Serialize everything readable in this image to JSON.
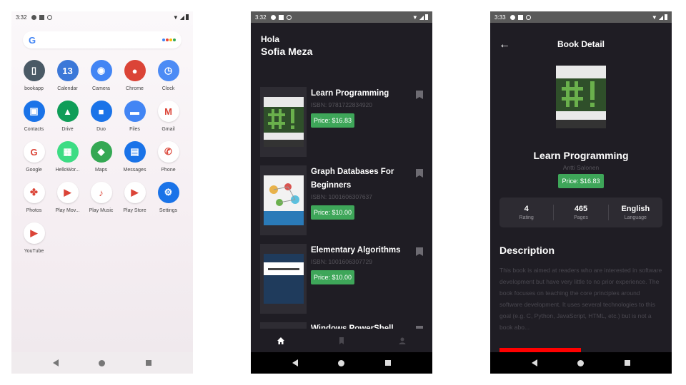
{
  "home": {
    "time": "3:32",
    "search": {
      "logo": "G"
    },
    "apps": [
      {
        "label": "bookapp",
        "icon": "bookmark-icon",
        "color": "#4a5a66",
        "glyph": "▯"
      },
      {
        "label": "Calendar",
        "icon": "calendar-icon",
        "color": "#3c78d8",
        "glyph": "13"
      },
      {
        "label": "Camera",
        "icon": "camera-icon",
        "color": "#4285f4",
        "glyph": "◉"
      },
      {
        "label": "Chrome",
        "icon": "chrome-icon",
        "color": "#db4437",
        "glyph": "●"
      },
      {
        "label": "Clock",
        "icon": "clock-icon",
        "color": "#4c8bf5",
        "glyph": "◷"
      },
      {
        "label": "Contacts",
        "icon": "contacts-icon",
        "color": "#1a73e8",
        "glyph": "▣"
      },
      {
        "label": "Drive",
        "icon": "drive-icon",
        "color": "#0f9d58",
        "glyph": "▲"
      },
      {
        "label": "Duo",
        "icon": "duo-icon",
        "color": "#1a73e8",
        "glyph": "■"
      },
      {
        "label": "Files",
        "icon": "files-icon",
        "color": "#4285f4",
        "glyph": "▬"
      },
      {
        "label": "Gmail",
        "icon": "gmail-icon",
        "color": "#ffffff",
        "glyph": "M"
      },
      {
        "label": "Google",
        "icon": "google-icon",
        "color": "#ffffff",
        "glyph": "G"
      },
      {
        "label": "HelloWor...",
        "icon": "android-icon",
        "color": "#3ddc84",
        "glyph": "▦"
      },
      {
        "label": "Maps",
        "icon": "maps-icon",
        "color": "#34a853",
        "glyph": "◆"
      },
      {
        "label": "Messages",
        "icon": "messages-icon",
        "color": "#1a73e8",
        "glyph": "▤"
      },
      {
        "label": "Phone",
        "icon": "phone-icon",
        "color": "#ffffff",
        "glyph": "✆"
      },
      {
        "label": "Photos",
        "icon": "photos-icon",
        "color": "#ffffff",
        "glyph": "✤"
      },
      {
        "label": "Play Mov...",
        "icon": "play-movies-icon",
        "color": "#ffffff",
        "glyph": "▶"
      },
      {
        "label": "Play Music",
        "icon": "play-music-icon",
        "color": "#ffffff",
        "glyph": "♪"
      },
      {
        "label": "Play Store",
        "icon": "play-store-icon",
        "color": "#ffffff",
        "glyph": "▶"
      },
      {
        "label": "Settings",
        "icon": "settings-icon",
        "color": "#1a73e8",
        "glyph": "⚙"
      },
      {
        "label": "YouTube",
        "icon": "youtube-icon",
        "color": "#ffffff",
        "glyph": "▶"
      }
    ]
  },
  "list": {
    "time": "3:32",
    "greeting": "Hola",
    "user_name": "Sofia Meza",
    "books": [
      {
        "title": "Learn Programming",
        "isbn": "ISBN: 9781722834920",
        "price": "Price: $16.83",
        "cover": "learn"
      },
      {
        "title": "Graph Databases For Beginners",
        "isbn": "ISBN: 1001606307637",
        "price": "Price: $10.00",
        "cover": "graph"
      },
      {
        "title": "Elementary Algorithms",
        "isbn": "ISBN: 1001606307729",
        "price": "Price: $10.00",
        "cover": "algo"
      },
      {
        "title": "Windows PowerShell",
        "isbn": "",
        "price": "",
        "cover": "ps"
      }
    ]
  },
  "detail": {
    "time": "3:33",
    "header_title": "Book Detail",
    "book_title": "Learn Programming",
    "author": "Antti Salonen",
    "price": "Price: $16.83",
    "stats": [
      {
        "value": "4",
        "label": "Rating"
      },
      {
        "value": "465",
        "label": "Pages"
      },
      {
        "value": "English",
        "label": "Language"
      }
    ],
    "description_heading": "Description",
    "description": "This book is aimed at readers who are interested in software development but have very little to no prior experience. The book focuses on teaching the core principles around software development. It uses several technologies to this goal (e.g. C, Python, JavaScript, HTML, etc.) but is not a book abo..."
  }
}
